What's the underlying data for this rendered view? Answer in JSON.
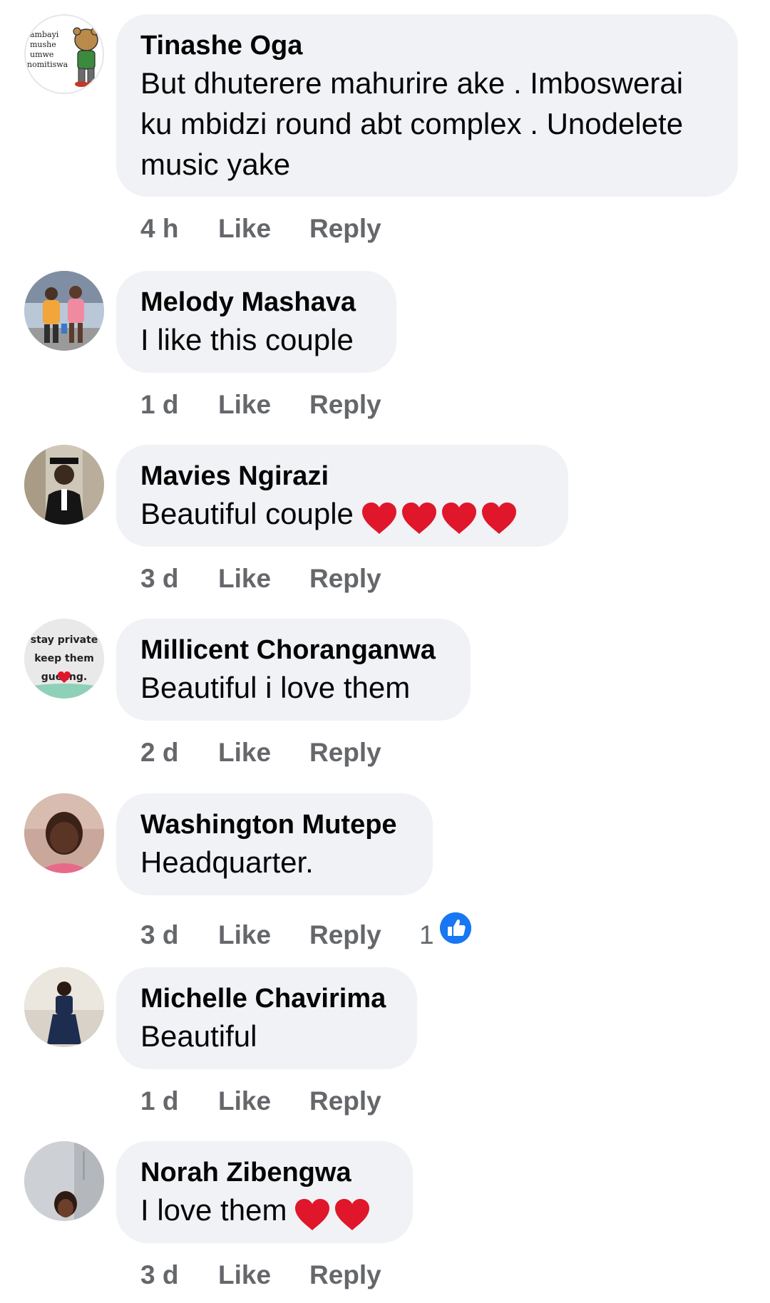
{
  "comments": [
    {
      "author": "Tinashe Oga",
      "lines": [
        "But dhuterere mahurire ake . Imboswerai",
        "ku mbidzi round abt complex . Unodelete",
        "music yake"
      ],
      "time": "4 h",
      "like_label": "Like",
      "reply_label": "Reply",
      "avatar_text": [
        "ambayi",
        "mushe",
        "umwe",
        "nomitiswa"
      ]
    },
    {
      "author": "Melody Mashava",
      "lines": [
        "I like this couple"
      ],
      "time": "1 d",
      "like_label": "Like",
      "reply_label": "Reply"
    },
    {
      "author": "Mavies Ngirazi",
      "lines": [
        "Beautiful couple"
      ],
      "hearts": 4,
      "time": "3 d",
      "like_label": "Like",
      "reply_label": "Reply"
    },
    {
      "author": "Millicent Choranganwa",
      "lines": [
        "Beautiful i love them"
      ],
      "time": "2 d",
      "like_label": "Like",
      "reply_label": "Reply",
      "avatar_text": [
        "stay private",
        "keep them",
        "gue  ing."
      ]
    },
    {
      "author": "Washington Mutepe",
      "lines": [
        "Headquarter."
      ],
      "time": "3 d",
      "like_label": "Like",
      "reply_label": "Reply",
      "reaction_count": "1",
      "reaction_icon": "like-icon"
    },
    {
      "author": "Michelle Chavirima",
      "lines": [
        "Beautiful"
      ],
      "time": "1 d",
      "like_label": "Like",
      "reply_label": "Reply"
    },
    {
      "author": "Norah Zibengwa",
      "lines": [
        "I love them"
      ],
      "hearts": 2,
      "time": "3 d",
      "like_label": "Like",
      "reply_label": "Reply"
    }
  ],
  "colors": {
    "bubble": "#f0f2f5",
    "meta_text": "#65676b",
    "like_blue": "#1877f2",
    "heart_red": "#e0162b"
  }
}
